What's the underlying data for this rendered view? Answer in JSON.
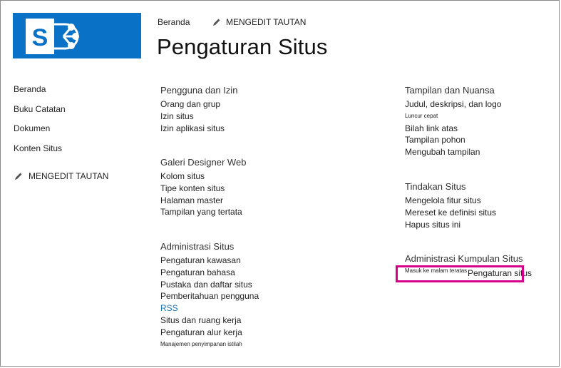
{
  "header": {
    "home_link": "Beranda",
    "edit_links": "MENGEDIT TAUTAN",
    "page_title": "Pengaturan Situs"
  },
  "quicklaunch": {
    "items": [
      "Beranda",
      "Buku Catatan",
      "Dokumen",
      "Konten Situs"
    ],
    "edit_links": "MENGEDIT TAUTAN"
  },
  "sections": {
    "users": {
      "heading": "Pengguna dan Izin",
      "links": [
        "Orang dan grup",
        "Izin situs",
        "Izin aplikasi situs"
      ]
    },
    "gallery": {
      "heading": "Galeri Designer Web",
      "links": [
        "Kolom situs",
        "Tipe konten situs",
        "Halaman master",
        "Tampilan yang tertata"
      ]
    },
    "admin": {
      "heading": "Administrasi Situs",
      "links": [
        "Pengaturan kawasan",
        "Pengaturan bahasa",
        "Pustaka dan daftar situs",
        "Pemberitahuan pengguna",
        "RSS",
        "Situs dan ruang kerja",
        "Pengaturan alur kerja",
        "Manajemen penyimpanan istilah"
      ]
    },
    "look": {
      "heading": "Tampilan dan Nuansa",
      "links": [
        "Judul, deskripsi, dan logo",
        "Luncur cepat",
        "Bilah link atas",
        "Tampilan pohon",
        "Mengubah tampilan"
      ]
    },
    "actions": {
      "heading": "Tindakan Situs",
      "links": [
        "Mengelola fitur situs",
        "Mereset ke definisi situs",
        "Hapus situs ini"
      ]
    },
    "collection": {
      "heading": "Administrasi Kumpulan Situs",
      "link_small": "Masuk ke malam teratas",
      "link_highlighted": "Pengaturan situs"
    }
  },
  "colors": {
    "logo_bg": "#0a72c6",
    "highlight_border": "#d4008a",
    "rss_link": "#1a73b8"
  }
}
